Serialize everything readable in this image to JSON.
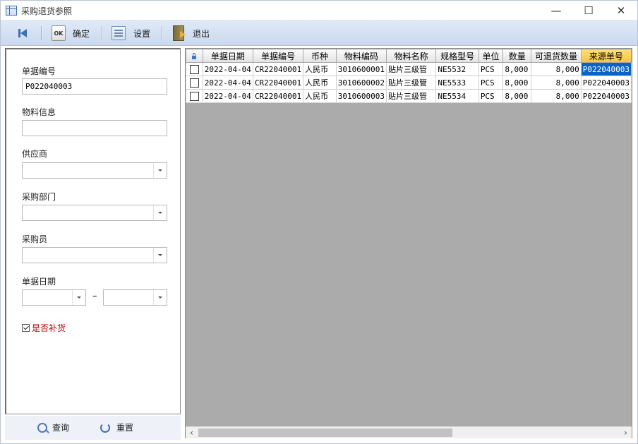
{
  "window": {
    "title": "采购退货参照"
  },
  "toolbar": {
    "confirm_label": "确定",
    "settings_label": "设置",
    "exit_label": "退出"
  },
  "filters": {
    "doc_no_label": "单据编号",
    "doc_no_value": "P022040003",
    "material_label": "物料信息",
    "material_value": "",
    "supplier_label": "供应商",
    "supplier_value": "",
    "dept_label": "采购部门",
    "dept_value": "",
    "buyer_label": "采购员",
    "buyer_value": "",
    "date_label": "单据日期",
    "date_from": "",
    "date_to": "",
    "date_sep": "–",
    "restock_label": "是否补货",
    "restock_checked": true
  },
  "actions": {
    "query_label": "查询",
    "reset_label": "重置"
  },
  "grid": {
    "columns": [
      "单据日期",
      "单据编号",
      "币种",
      "物料编码",
      "物料名称",
      "规格型号",
      "单位",
      "数量",
      "可退货数量",
      "来源单号"
    ],
    "rows": [
      [
        "2022-04-04",
        "CR22040001",
        "人民币",
        "3010600001",
        "贴片三级管",
        "NE5532",
        "PCS",
        "8,000",
        "8,000",
        "P022040003"
      ],
      [
        "2022-04-04",
        "CR22040001",
        "人民币",
        "3010600002",
        "贴片三级管",
        "NE5533",
        "PCS",
        "8,000",
        "8,000",
        "P022040003"
      ],
      [
        "2022-04-04",
        "CR22040001",
        "人民币",
        "3010600003",
        "贴片三级管",
        "NE5534",
        "PCS",
        "8,000",
        "8,000",
        "P022040003"
      ]
    ]
  },
  "colors": {
    "toolbar_bg": "#d3e0f2",
    "grid_empty_bg": "#ababab",
    "selected_cell": "#0a64c8",
    "active_header": "#f6c23d",
    "restock_text": "#b00000"
  }
}
